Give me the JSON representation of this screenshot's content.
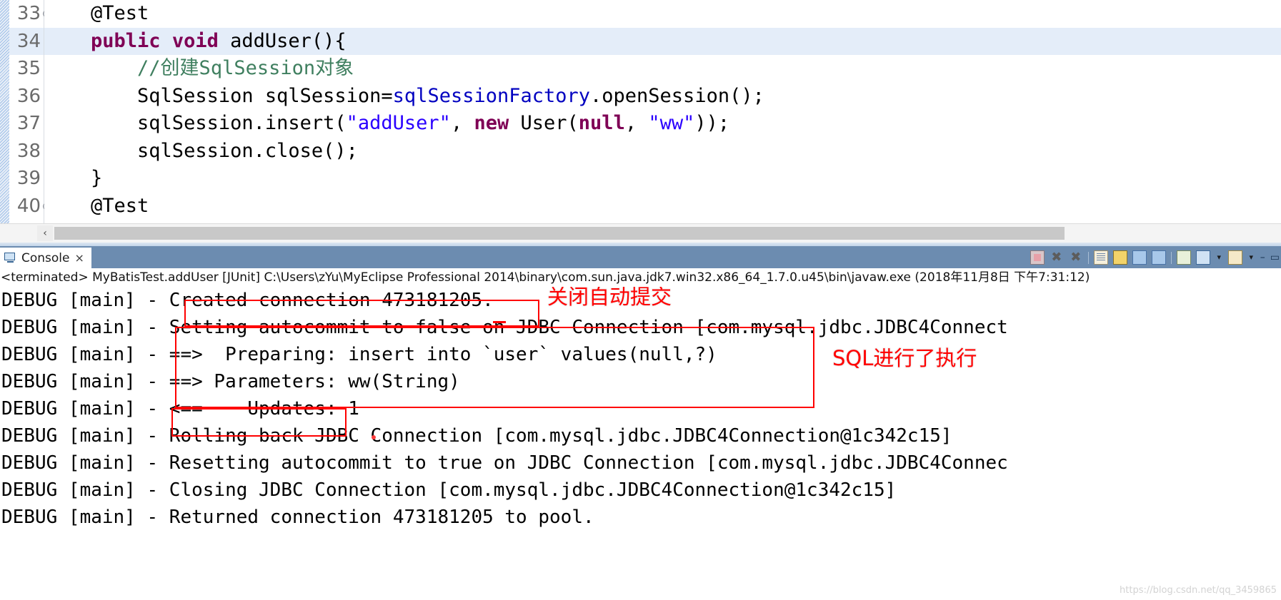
{
  "editor": {
    "lines": [
      {
        "num": "33",
        "fold": "⊖",
        "highlight": false,
        "segments": [
          {
            "text": "    ",
            "cls": ""
          },
          {
            "text": "@Test",
            "cls": ""
          }
        ]
      },
      {
        "num": "34",
        "fold": "",
        "highlight": true,
        "segments": [
          {
            "text": "    ",
            "cls": ""
          },
          {
            "text": "public void",
            "cls": "kw"
          },
          {
            "text": " addUser(){",
            "cls": ""
          }
        ]
      },
      {
        "num": "35",
        "fold": "",
        "highlight": false,
        "segments": [
          {
            "text": "        ",
            "cls": ""
          },
          {
            "text": "//创建SqlSession对象",
            "cls": "cmt"
          }
        ]
      },
      {
        "num": "36",
        "fold": "",
        "highlight": false,
        "segments": [
          {
            "text": "        SqlSession sqlSession=",
            "cls": ""
          },
          {
            "text": "sqlSessionFactory",
            "cls": "fld"
          },
          {
            "text": ".openSession();",
            "cls": ""
          }
        ]
      },
      {
        "num": "37",
        "fold": "",
        "highlight": false,
        "segments": [
          {
            "text": "        sqlSession.insert(",
            "cls": ""
          },
          {
            "text": "\"addUser\"",
            "cls": "str"
          },
          {
            "text": ", ",
            "cls": ""
          },
          {
            "text": "new",
            "cls": "kw"
          },
          {
            "text": " User(",
            "cls": ""
          },
          {
            "text": "null",
            "cls": "kw"
          },
          {
            "text": ", ",
            "cls": ""
          },
          {
            "text": "\"ww\"",
            "cls": "str"
          },
          {
            "text": "));",
            "cls": ""
          }
        ]
      },
      {
        "num": "38",
        "fold": "",
        "highlight": false,
        "segments": [
          {
            "text": "        sqlSession.close();",
            "cls": ""
          }
        ]
      },
      {
        "num": "39",
        "fold": "",
        "highlight": false,
        "segments": [
          {
            "text": "    }",
            "cls": ""
          }
        ]
      },
      {
        "num": "40",
        "fold": "⊖",
        "highlight": false,
        "segments": [
          {
            "text": "    ",
            "cls": ""
          },
          {
            "text": "@Test",
            "cls": ""
          }
        ]
      }
    ],
    "hscroll": {
      "left_arrow": "‹"
    }
  },
  "console": {
    "tab": {
      "label": "Console",
      "close": "×",
      "icon": "monitor-icon"
    },
    "toolbar": [
      {
        "name": "terminate-button",
        "glyph": ""
      },
      {
        "name": "remove-launch-button",
        "glyph": "✖"
      },
      {
        "name": "remove-all-terminated-button",
        "glyph": "✖"
      },
      {
        "name": "separator-1",
        "glyph": ""
      },
      {
        "name": "clear-console-button",
        "glyph": ""
      },
      {
        "name": "scroll-lock-button",
        "glyph": ""
      },
      {
        "name": "show-console-on-output-button",
        "glyph": ""
      },
      {
        "name": "show-console-on-error-button",
        "glyph": ""
      },
      {
        "name": "separator-2",
        "glyph": ""
      },
      {
        "name": "pin-console-button",
        "glyph": ""
      },
      {
        "name": "display-selected-console-button",
        "glyph": ""
      },
      {
        "name": "display-console-dropdown",
        "glyph": "▾"
      },
      {
        "name": "open-console-button",
        "glyph": ""
      },
      {
        "name": "open-console-dropdown",
        "glyph": "▾"
      },
      {
        "name": "minimize-button",
        "glyph": "–"
      },
      {
        "name": "maximize-button",
        "glyph": "▭"
      }
    ],
    "status_line": "<terminated> MyBatisTest.addUser [JUnit] C:\\Users\\zYu\\MyEclipse Professional 2014\\binary\\com.sun.java.jdk7.win32.x86_64_1.7.0.u45\\bin\\javaw.exe (2018年11月8日 下午7:31:12)",
    "log_lines": [
      "DEBUG [main] - Created connection 473181205.",
      "DEBUG [main] - Setting autocommit to false on JDBC Connection [com.mysql.jdbc.JDBC4Connect",
      "DEBUG [main] - ==>  Preparing: insert into `user` values(null,?)",
      "DEBUG [main] - ==> Parameters: ww(String)",
      "DEBUG [main] - <==    Updates: 1",
      "DEBUG [main] - Rolling back JDBC Connection [com.mysql.jdbc.JDBC4Connection@1c342c15]",
      "DEBUG [main] - Resetting autocommit to true on JDBC Connection [com.mysql.jdbc.JDBC4Connec",
      "DEBUG [main] - Closing JDBC Connection [com.mysql.jdbc.JDBC4Connection@1c342c15]",
      "DEBUG [main] - Returned connection 473181205 to pool."
    ],
    "annotations": [
      {
        "name": "annotation-close-autocommit",
        "text": "关闭自动提交"
      },
      {
        "name": "annotation-sql-executed",
        "text": "SQL进行了执行"
      }
    ],
    "watermark": "https://blog.csdn.net/qq_3459865"
  }
}
